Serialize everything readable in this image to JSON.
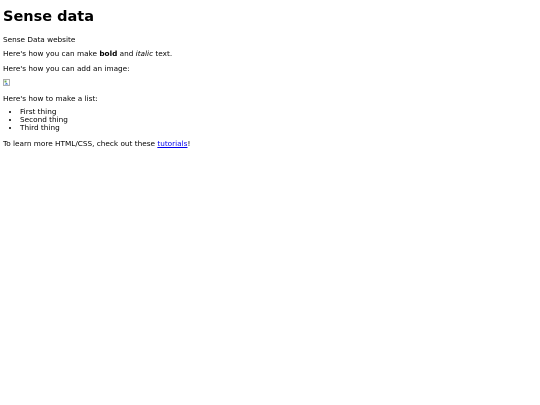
{
  "heading": "Sense data",
  "intro": "Sense Data website",
  "bold_line": {
    "before": "Here's how you can make ",
    "bold": "bold",
    "middle": " and ",
    "italic": "italic",
    "after": " text."
  },
  "image_line": "Here's how you can add an image:",
  "list_intro": "Here's how to make a list:",
  "list_items": [
    "First thing",
    "Second thing",
    "Third thing"
  ],
  "learn_line": {
    "before": "To learn more HTML/CSS, check out these ",
    "link": "tutorials",
    "after": "!"
  },
  "colors": {
    "link": "#0000ee",
    "text": "#000000",
    "background": "#ffffff"
  },
  "icons": {
    "broken_image": "broken-image-icon"
  }
}
